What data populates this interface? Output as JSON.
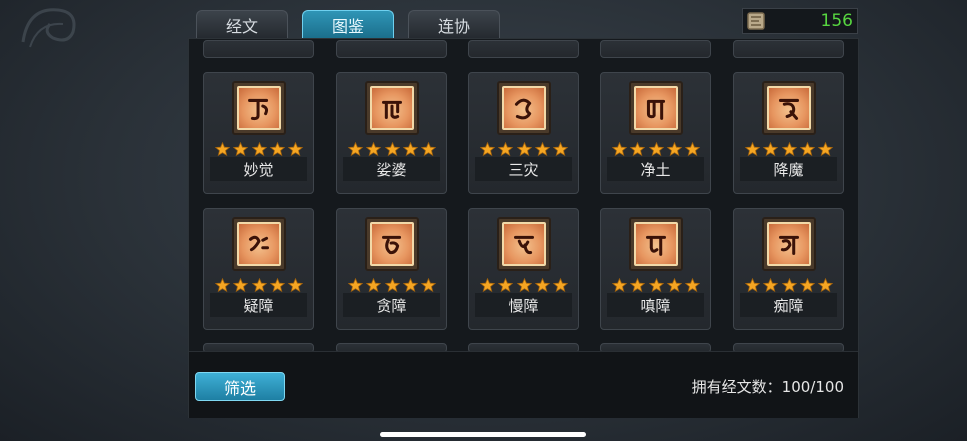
{
  "tabs": [
    {
      "label": "经文",
      "active": false
    },
    {
      "label": "图鉴",
      "active": true
    },
    {
      "label": "连协",
      "active": false
    }
  ],
  "counter": {
    "icon": "scroll-icon",
    "value": "156"
  },
  "cards": [
    {
      "name": "妙觉",
      "stars": 5,
      "glyph": "sanskrit-glyph-1"
    },
    {
      "name": "娑婆",
      "stars": 5,
      "glyph": "sanskrit-glyph-2"
    },
    {
      "name": "三灾",
      "stars": 5,
      "glyph": "sanskrit-glyph-3"
    },
    {
      "name": "净土",
      "stars": 5,
      "glyph": "sanskrit-glyph-4"
    },
    {
      "name": "降魔",
      "stars": 5,
      "glyph": "sanskrit-glyph-5"
    },
    {
      "name": "疑障",
      "stars": 5,
      "glyph": "sanskrit-glyph-6"
    },
    {
      "name": "贪障",
      "stars": 5,
      "glyph": "sanskrit-glyph-7"
    },
    {
      "name": "慢障",
      "stars": 5,
      "glyph": "sanskrit-glyph-8"
    },
    {
      "name": "嗔障",
      "stars": 5,
      "glyph": "sanskrit-glyph-9"
    },
    {
      "name": "痴障",
      "stars": 5,
      "glyph": "sanskrit-glyph-10"
    }
  ],
  "footer": {
    "filter_label": "筛选",
    "owned_text": "拥有经文数：100/100"
  },
  "colors": {
    "accent": "#2f95b6",
    "counter": "#57d640",
    "star": "#f5a623",
    "tile": "#e79660"
  }
}
